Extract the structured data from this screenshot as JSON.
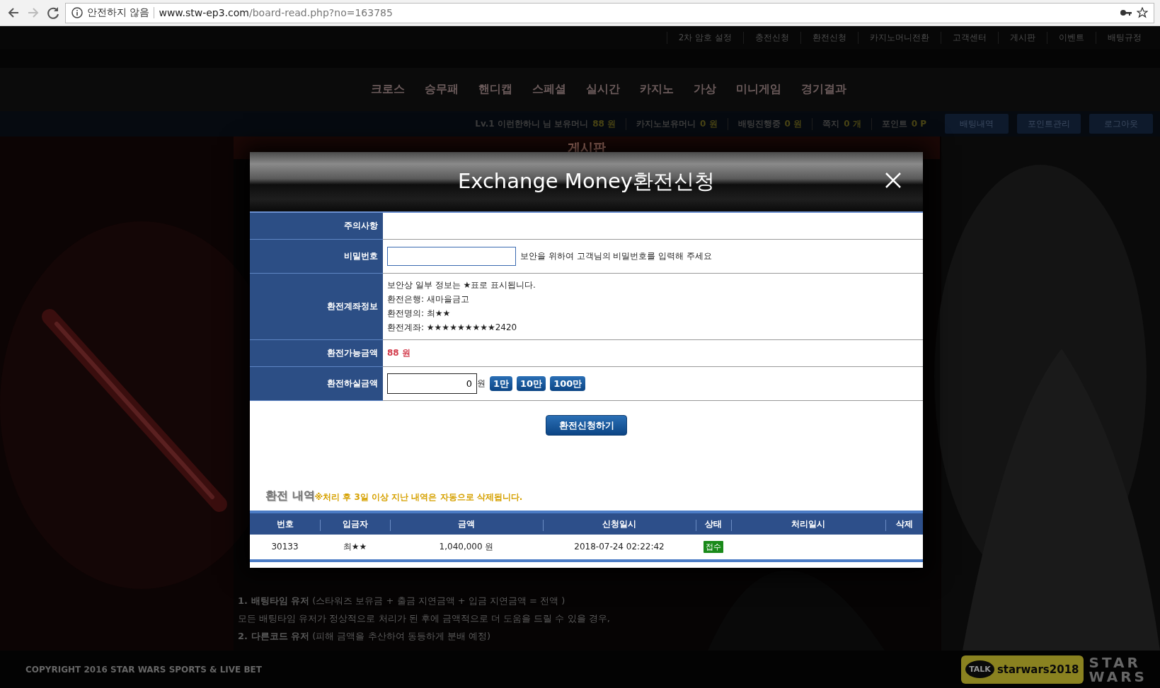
{
  "browser": {
    "security_label": "안전하지 않음",
    "url_host": "www.stw-ep3.com",
    "url_path": "/board-read.php?no=163785"
  },
  "top_links": [
    "2차 암호 설정",
    "충전신청",
    "환전신청",
    "카지노머니전환",
    "고객센터",
    "게시판",
    "이벤트",
    "배팅규정"
  ],
  "main_nav": [
    "크로스",
    "승무패",
    "핸디캡",
    "스페셜",
    "실시간",
    "카지노",
    "가상",
    "미니게임",
    "경기결과"
  ],
  "account_bar": {
    "stats": [
      {
        "label": "Lv.1 이런한하니 님 보유머니",
        "value": "88 원"
      },
      {
        "label": "카지노보유머니",
        "value": "0 원"
      },
      {
        "label": "배팅진행중",
        "value": "0 원"
      },
      {
        "label": "쪽지",
        "value": "0 개"
      },
      {
        "label": "포인트",
        "value": "0 P"
      }
    ],
    "buttons": [
      "배팅내역",
      "포인트관리",
      "로그아웃"
    ]
  },
  "board": {
    "title": "게시판",
    "lines": [
      "**1. 배팅타임 유저** (스타워즈 보유금 + 출금 지연금액 + 입금 지연금액 = 전액 )",
      "모든 배팅타임 유저가 정상적으로 처리가 된 후에 금액적으로 더 도움을 드릴 수 있을 경우,",
      "**2. 다른코드 유저** (피해 금액을 추산하여 동등하게 분배 예정)"
    ]
  },
  "footer": {
    "copyright": "COPYRIGHT 2016 STAR WARS SPORTS & LIVE BET",
    "talk_badge": "TALK",
    "talk_id": "starwars2018",
    "logo_lines": [
      "STAR",
      "WARS"
    ]
  },
  "modal": {
    "title": "Exchange Money환전신청",
    "rows": [
      {
        "kind": "notice",
        "label": "주의사항"
      },
      {
        "kind": "password",
        "label": "비밀번호",
        "hint": "보안을 위하여 고객님의 비밀번호를 입력해 주세요"
      },
      {
        "kind": "lines",
        "label": "환전계좌정보",
        "lines": [
          "보안상 일부 정보는 ★표로 표시됩니다.",
          "환전은행: 새마을금고",
          "환전명의: 최★★",
          "환전계좌: ★★★★★★★★★2420"
        ]
      },
      {
        "kind": "amount",
        "label": "환전가능금액",
        "value": "88 원"
      },
      {
        "kind": "entry",
        "label": "환전하실금액",
        "value": "0",
        "unit": "원",
        "quick_buttons": [
          "1만",
          "10만",
          "100만"
        ]
      }
    ],
    "submit": "환전신청하기",
    "history": {
      "title": "환전 내역",
      "note": "※처리 후 3일 이상 지난 내역은 자동으로 삭제됩니다.",
      "columns": [
        "번호",
        "입금자",
        "금액",
        "신청일시",
        "상태",
        "처리일시",
        "삭제"
      ],
      "rows": [
        {
          "no": "30133",
          "depositor": "최★★",
          "amount": "1,040,000 원",
          "requested": "2018-07-24 02:22:42",
          "status": "접수"
        }
      ]
    }
  }
}
